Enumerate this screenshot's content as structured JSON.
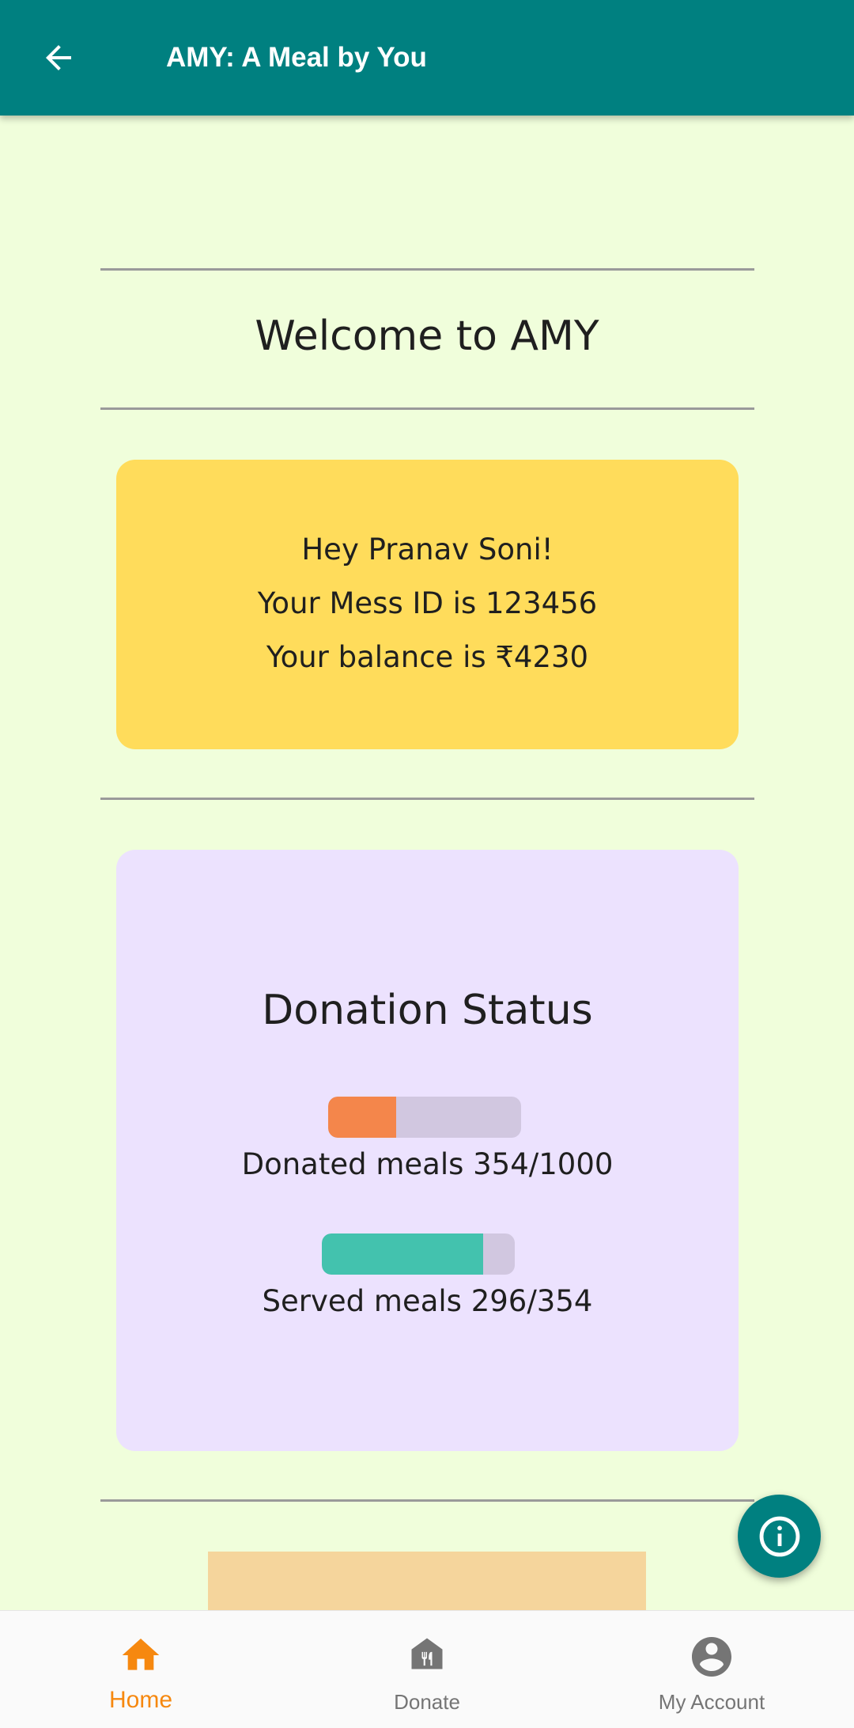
{
  "app_bar": {
    "title": "AMY: A Meal by You",
    "back_icon": "arrow-back-icon",
    "color": "#008080"
  },
  "main": {
    "welcome": "Welcome to AMY",
    "user_card": {
      "greeting": "Hey Pranav Soni!",
      "mess_id": "Your Mess ID is 123456",
      "balance": "Your balance is ₹4230",
      "color": "#ffdc5b"
    },
    "donation_status": {
      "title": "Donation Status",
      "donated": {
        "label": "Donated meals 354/1000",
        "progress": 0.354,
        "color": "#f4864b"
      },
      "served": {
        "label": "Served meals 296/354",
        "progress": 0.836,
        "color": "#43c2ae"
      },
      "color": "#ece2fe"
    }
  },
  "fab": {
    "icon": "info-icon"
  },
  "bottom_nav": {
    "items": [
      {
        "label": "Home",
        "icon": "home-icon",
        "active": true
      },
      {
        "label": "Donate",
        "icon": "restaurant-icon",
        "active": false
      },
      {
        "label": "My Account",
        "icon": "account-circle-icon",
        "active": false
      }
    ],
    "active_color": "#f6880f",
    "inactive_color": "#757575"
  }
}
